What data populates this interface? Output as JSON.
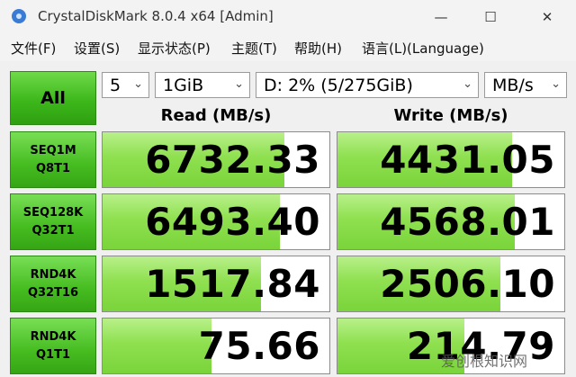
{
  "window": {
    "title": "CrystalDiskMark 8.0.4 x64 [Admin]",
    "minimize_glyph": "—",
    "maximize_glyph": "☐",
    "close_glyph": "✕"
  },
  "menu": [
    "文件(F)",
    "设置(S)",
    "显示状态(P)",
    "主题(T)",
    "帮助(H)",
    "语言(L)(Language)"
  ],
  "controls": {
    "all_label": "All",
    "count": "5",
    "size": "1GiB",
    "drive": "D: 2% (5/275GiB)",
    "unit": "MB/s"
  },
  "columns": {
    "read": "Read (MB/s)",
    "write": "Write (MB/s)"
  },
  "rows": [
    {
      "line1": "SEQ1M",
      "line2": "Q8T1",
      "read": "6732.33",
      "write": "4431.05",
      "read_fill": 0.8,
      "write_fill": 0.77
    },
    {
      "line1": "SEQ128K",
      "line2": "Q32T1",
      "read": "6493.40",
      "write": "4568.01",
      "read_fill": 0.78,
      "write_fill": 0.78
    },
    {
      "line1": "RND4K",
      "line2": "Q32T16",
      "read": "1517.84",
      "write": "2506.10",
      "read_fill": 0.7,
      "write_fill": 0.72
    },
    {
      "line1": "RND4K",
      "line2": "Q1T1",
      "read": "75.66",
      "write": "214.79",
      "read_fill": 0.48,
      "write_fill": 0.56
    }
  ],
  "watermark": "爱创根知识网"
}
